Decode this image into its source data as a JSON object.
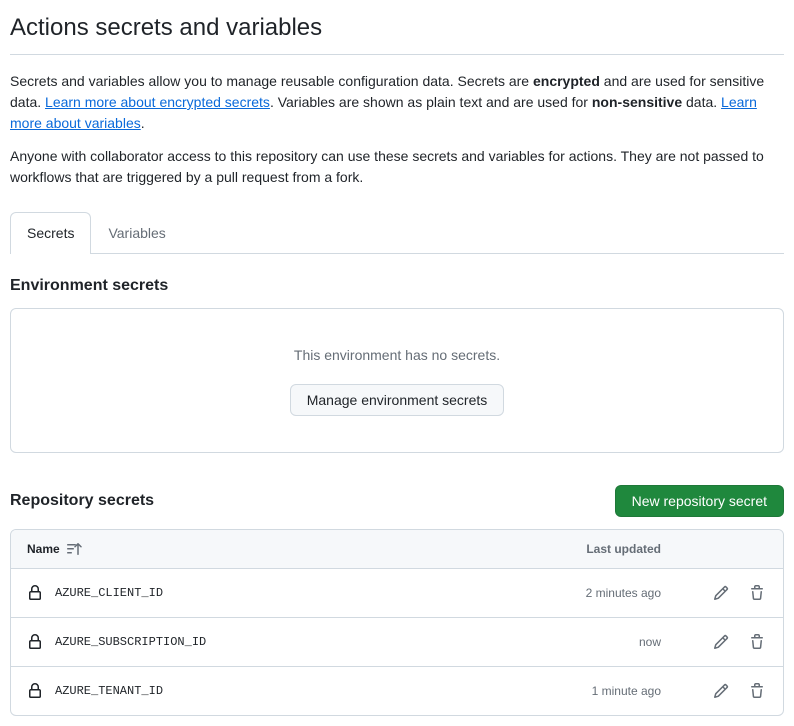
{
  "page": {
    "title": "Actions secrets and variables",
    "desc_text_1a": "Secrets and variables allow you to manage reusable configuration data. Secrets are ",
    "desc_bold_1": "encrypted",
    "desc_text_1b": " and are used for sensitive data. ",
    "desc_link_1": "Learn more about encrypted secrets",
    "desc_text_1c": ". Variables are shown as plain text and are used for ",
    "desc_bold_2": "non-sensitive",
    "desc_text_1d": " data. ",
    "desc_link_2": "Learn more about variables",
    "desc_text_1e": ".",
    "desc_text_2": "Anyone with collaborator access to this repository can use these secrets and variables for actions. They are not passed to workflows that are triggered by a pull request from a fork."
  },
  "tabs": {
    "secrets": "Secrets",
    "variables": "Variables"
  },
  "environment": {
    "heading": "Environment secrets",
    "empty_text": "This environment has no secrets.",
    "manage_button": "Manage environment secrets"
  },
  "repository": {
    "heading": "Repository secrets",
    "new_button": "New repository secret",
    "col_name": "Name",
    "col_updated": "Last updated",
    "rows": [
      {
        "name": "AZURE_CLIENT_ID",
        "updated": "2 minutes ago"
      },
      {
        "name": "AZURE_SUBSCRIPTION_ID",
        "updated": "now"
      },
      {
        "name": "AZURE_TENANT_ID",
        "updated": "1 minute ago"
      }
    ]
  }
}
